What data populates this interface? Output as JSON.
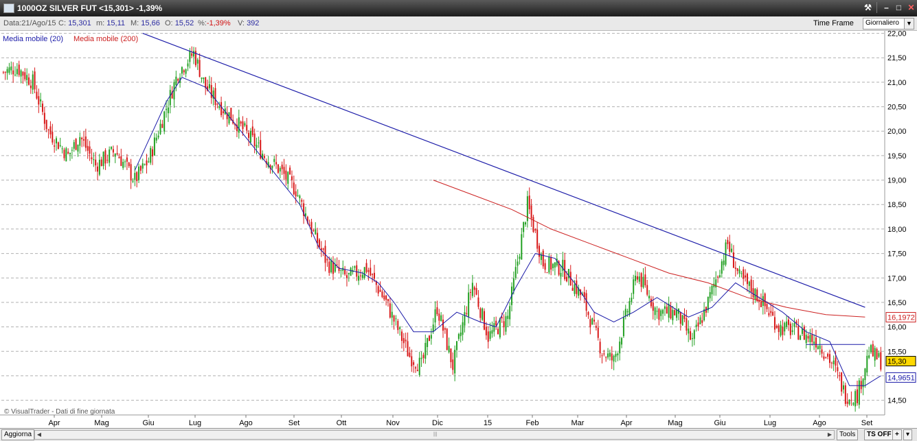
{
  "window": {
    "title": "1000OZ SILVER FUT <15,301> -1,39%",
    "icons": [
      "app-chart-icon",
      "wrench-icon",
      "minimize-icon",
      "maximize-icon",
      "close-icon"
    ]
  },
  "infobar": {
    "date_label": "Data:",
    "date_value": "21/Ago/15",
    "close_label": "C:",
    "close_value": "15,301",
    "low_label": "m:",
    "low_value": "15,11",
    "high_label": "M:",
    "high_value": "15,66",
    "open_label": "O:",
    "open_value": "15,52",
    "pct_label": "%:",
    "pct_value": "-1,39%",
    "vol_label": "V:",
    "vol_value": "392",
    "timeframe_label": "Time Frame",
    "timeframe_value": "Giornaliero"
  },
  "legend": {
    "ma20": "Media mobile (20)",
    "ma200": "Media mobile (200)"
  },
  "watermark": "© VisualTrader - Dati di fine giornata",
  "price_tags": {
    "ma200": "16,1972",
    "last": "15,30",
    "ma20": "14,9651"
  },
  "colors": {
    "ma20": "#1a1aa8",
    "ma200": "#cc2020",
    "up": "#22a022",
    "down": "#d81818",
    "trendline": "#1a1aa8"
  },
  "bottom": {
    "refresh": "Aggiorna",
    "tools": "Tools",
    "ts": "TS OFF",
    "plus": "+",
    "more": "▾"
  },
  "chart_data": {
    "type": "candlestick",
    "ylim": [
      14.2,
      22.05
    ],
    "y_ticks": [
      "22,00",
      "21,50",
      "21,00",
      "20,50",
      "20,00",
      "19,50",
      "19,00",
      "18,50",
      "18,00",
      "17,50",
      "17,00",
      "16,50",
      "16,00",
      "15,50",
      "15,00",
      "14,50"
    ],
    "x_ticks": [
      "Apr",
      "Mag",
      "Giu",
      "Lug",
      "Ago",
      "Set",
      "Ott",
      "Nov",
      "Dic",
      "15",
      "Feb",
      "Mar",
      "Apr",
      "Mag",
      "Giu",
      "Lug",
      "Ago",
      "Set"
    ],
    "price_path": [
      [
        0,
        21.2
      ],
      [
        8,
        21.3
      ],
      [
        16,
        21.0
      ],
      [
        24,
        20.0
      ],
      [
        34,
        19.5
      ],
      [
        40,
        19.9
      ],
      [
        48,
        19.3
      ],
      [
        58,
        19.6
      ],
      [
        68,
        19.0
      ],
      [
        75,
        19.4
      ],
      [
        90,
        21.2
      ],
      [
        98,
        21.6
      ],
      [
        104,
        20.9
      ],
      [
        112,
        20.5
      ],
      [
        124,
        20.0
      ],
      [
        134,
        19.5
      ],
      [
        142,
        19.2
      ],
      [
        150,
        18.8
      ],
      [
        158,
        18.0
      ],
      [
        166,
        17.3
      ],
      [
        176,
        17.0
      ],
      [
        186,
        17.2
      ],
      [
        196,
        16.5
      ],
      [
        208,
        15.4
      ],
      [
        214,
        15.2
      ],
      [
        222,
        16.4
      ],
      [
        230,
        15.2
      ],
      [
        240,
        16.9
      ],
      [
        248,
        15.8
      ],
      [
        258,
        16.2
      ],
      [
        268,
        18.5
      ],
      [
        276,
        17.3
      ],
      [
        286,
        17.2
      ],
      [
        296,
        16.6
      ],
      [
        306,
        15.5
      ],
      [
        312,
        15.3
      ],
      [
        324,
        17.1
      ],
      [
        334,
        16.3
      ],
      [
        344,
        16.3
      ],
      [
        352,
        15.7
      ],
      [
        360,
        16.5
      ],
      [
        370,
        17.7
      ],
      [
        376,
        17.0
      ],
      [
        386,
        16.6
      ],
      [
        396,
        16.0
      ],
      [
        406,
        15.9
      ],
      [
        416,
        15.7
      ],
      [
        424,
        15.2
      ],
      [
        430,
        14.6
      ],
      [
        436,
        14.6
      ],
      [
        442,
        15.5
      ],
      [
        448,
        15.3
      ]
    ],
    "ma20_path": [
      [
        68,
        19.2
      ],
      [
        76,
        19.9
      ],
      [
        84,
        20.6
      ],
      [
        92,
        21.1
      ],
      [
        104,
        20.9
      ],
      [
        116,
        20.3
      ],
      [
        128,
        19.7
      ],
      [
        140,
        19.1
      ],
      [
        152,
        18.5
      ],
      [
        162,
        17.6
      ],
      [
        172,
        17.2
      ],
      [
        184,
        17.1
      ],
      [
        192,
        16.9
      ],
      [
        200,
        16.5
      ],
      [
        210,
        15.9
      ],
      [
        220,
        15.9
      ],
      [
        232,
        16.3
      ],
      [
        244,
        16.1
      ],
      [
        252,
        16.0
      ],
      [
        262,
        16.8
      ],
      [
        272,
        17.5
      ],
      [
        282,
        17.4
      ],
      [
        292,
        16.9
      ],
      [
        302,
        16.3
      ],
      [
        312,
        16.1
      ],
      [
        322,
        16.3
      ],
      [
        334,
        16.6
      ],
      [
        342,
        16.4
      ],
      [
        350,
        16.2
      ],
      [
        362,
        16.4
      ],
      [
        374,
        16.9
      ],
      [
        386,
        16.6
      ],
      [
        398,
        16.3
      ],
      [
        410,
        15.9
      ],
      [
        422,
        15.7
      ],
      [
        432,
        14.8
      ],
      [
        440,
        14.8
      ],
      [
        448,
        15.0
      ]
    ],
    "ma200_path": [
      [
        220,
        19.0
      ],
      [
        240,
        18.7
      ],
      [
        260,
        18.4
      ],
      [
        280,
        18.0
      ],
      [
        300,
        17.7
      ],
      [
        320,
        17.4
      ],
      [
        340,
        17.1
      ],
      [
        360,
        16.9
      ],
      [
        380,
        16.6
      ],
      [
        400,
        16.4
      ],
      [
        420,
        16.25
      ],
      [
        440,
        16.2
      ]
    ],
    "trendline": [
      [
        72,
        22.0
      ],
      [
        440,
        16.4
      ]
    ],
    "resistance_line": [
      [
        410,
        15.64
      ],
      [
        440,
        15.64
      ]
    ]
  }
}
